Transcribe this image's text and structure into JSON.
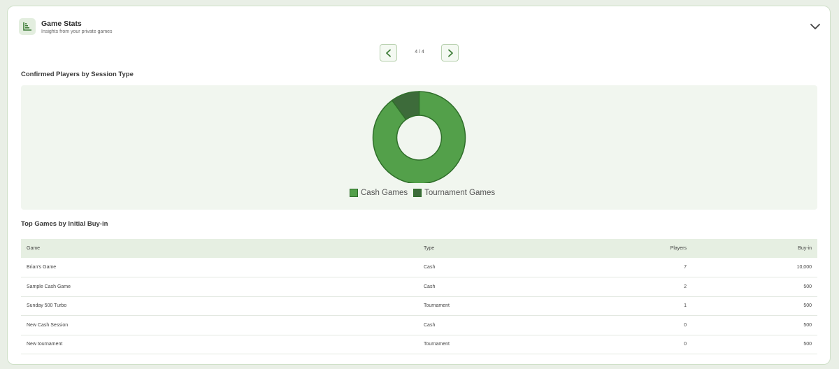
{
  "header": {
    "title": "Game Stats",
    "subtitle": "Insights from your private games",
    "icon": "bar-chart-icon",
    "toggle_icon": "chevron-down-icon"
  },
  "pager": {
    "indicator": "4 / 4",
    "prev_icon": "chevron-left-icon",
    "next_icon": "chevron-right-icon"
  },
  "sections": {
    "chart_title": "Confirmed Players by Session Type",
    "table_title": "Top Games by Initial Buy-in"
  },
  "colors": {
    "accent": "#4e9a47",
    "cash": "#53a04a",
    "tournament": "#3d6b3a",
    "border": "#2f6e2a"
  },
  "chart_data": {
    "type": "pie",
    "donut": true,
    "categories": [
      "Cash Games",
      "Tournament Games"
    ],
    "values": [
      9,
      1
    ],
    "legend": "bottom",
    "title": ""
  },
  "table": {
    "columns": [
      "Game",
      "Type",
      "Players",
      "Buy-in"
    ],
    "rows": [
      [
        "Brian's Game",
        "Cash",
        "7",
        "10,000"
      ],
      [
        "Sample Cash Game",
        "Cash",
        "2",
        "500"
      ],
      [
        "Sunday 500 Turbo",
        "Tournament",
        "1",
        "500"
      ],
      [
        "New Cash Session",
        "Cash",
        "0",
        "500"
      ],
      [
        "New tournament",
        "Tournament",
        "0",
        "500"
      ]
    ]
  }
}
